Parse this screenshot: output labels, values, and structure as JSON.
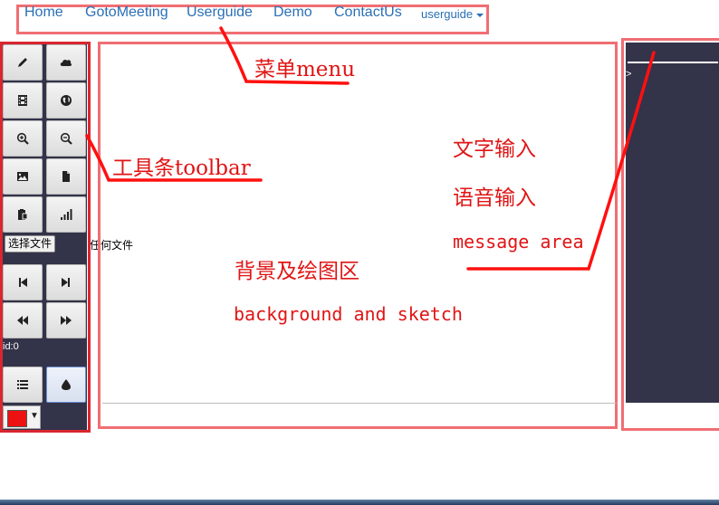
{
  "nav": {
    "items": [
      {
        "label": "Home"
      },
      {
        "label": "GotoMeeting"
      },
      {
        "label": "Userguide"
      },
      {
        "label": "Demo"
      },
      {
        "label": "ContactUs"
      }
    ],
    "dropdown_label": "userguide",
    "link_color": "#2a6fb5"
  },
  "toolbar": {
    "buttons_top": [
      {
        "icon": "pencil-icon"
      },
      {
        "icon": "cloud-icon"
      },
      {
        "icon": "film-icon"
      },
      {
        "icon": "globe-icon"
      },
      {
        "icon": "zoom-in-icon"
      },
      {
        "icon": "zoom-out-icon"
      },
      {
        "icon": "image-icon"
      },
      {
        "icon": "document-icon"
      },
      {
        "icon": "clipboard-icon"
      },
      {
        "icon": "signal-bars-icon"
      }
    ],
    "file_button_label": "选择文件",
    "file_status": "任何文件",
    "buttons_nav": [
      {
        "icon": "step-backward-icon"
      },
      {
        "icon": "step-forward-icon"
      },
      {
        "icon": "backward-icon"
      },
      {
        "icon": "forward-icon"
      }
    ],
    "id_label": "id:0",
    "buttons_bottom": [
      {
        "icon": "list-icon"
      },
      {
        "icon": "ink-drop-icon"
      }
    ],
    "color_value": "#ee1111",
    "color_arrow": "▼",
    "background_color": "#33334a"
  },
  "message_panel": {
    "input_value": "",
    "prompt": ">"
  },
  "annotations": {
    "menu": "菜单menu",
    "toolbar": "工具条toolbar",
    "text_input": "文字输入",
    "voice_input": "语音输入",
    "message_area": "message area",
    "canvas_cn": "背景及绘图区",
    "canvas_en": "background and sketch",
    "color": "#e01515"
  }
}
